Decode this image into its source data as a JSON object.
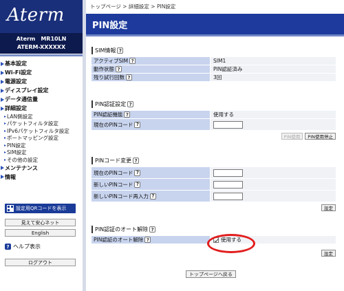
{
  "brand": {
    "logo": "Aterm",
    "model_line1": "Aterm　MR10LN",
    "model_line2": "ATERM-XXXXXX"
  },
  "nav": [
    {
      "label": "基本設定",
      "type": "cat"
    },
    {
      "label": "Wi-Fi設定",
      "type": "cat"
    },
    {
      "label": "電源設定",
      "type": "cat"
    },
    {
      "label": "ディスプレイ設定",
      "type": "cat"
    },
    {
      "label": "データ通信量",
      "type": "cat"
    },
    {
      "label": "詳細設定",
      "type": "cat"
    },
    {
      "label": "LAN側設定",
      "type": "sub"
    },
    {
      "label": "パケットフィルタ設定",
      "type": "sub"
    },
    {
      "label": "IPv6パケットフィルタ設定",
      "type": "sub"
    },
    {
      "label": "ポートマッピング設定",
      "type": "sub"
    },
    {
      "label": "PIN設定",
      "type": "sub"
    },
    {
      "label": "SIM設定",
      "type": "sub"
    },
    {
      "label": "その他の設定",
      "type": "sub"
    },
    {
      "label": "メンテナンス",
      "type": "cat"
    },
    {
      "label": "情報",
      "type": "cat"
    }
  ],
  "sidebar_buttons": {
    "qr": "設定用QRコードを表示",
    "mieru": "見えて安心ネット",
    "english": "English",
    "help": "ヘルプ表示",
    "logout": "ログアウト"
  },
  "breadcrumb": "トップページ > 詳細設定 > PIN設定",
  "page_title": "PIN設定",
  "sim_info": {
    "title": "SIM情報",
    "rows": [
      {
        "label": "アクティブSIM",
        "value": "SIM1"
      },
      {
        "label": "動作状態",
        "value": "PIN認証済み"
      },
      {
        "label": "残り試行回数",
        "value": "3回"
      }
    ]
  },
  "pin_auth": {
    "title": "PIN認証設定",
    "func_label": "PIN認証機能",
    "func_value": "使用する",
    "code_label": "現在のPINコード",
    "btn_use": "PIN使用",
    "btn_stop": "PIN使用停止"
  },
  "pin_change": {
    "title": "PINコード変更",
    "rows": [
      "現在のPINコード",
      "新しいPINコード",
      "新しいPINコード再入力"
    ],
    "btn_set": "設定"
  },
  "auto_release": {
    "title": "PIN認証のオート解除",
    "label": "PIN認証のオート解除",
    "checkbox_label": "使用する",
    "btn_set": "設定"
  },
  "home_button": "トップページへ戻る",
  "colors": {
    "header_blue": "#1d3a9c",
    "label_blue": "#c8d4ee",
    "highlight_red": "#e21d1d"
  }
}
